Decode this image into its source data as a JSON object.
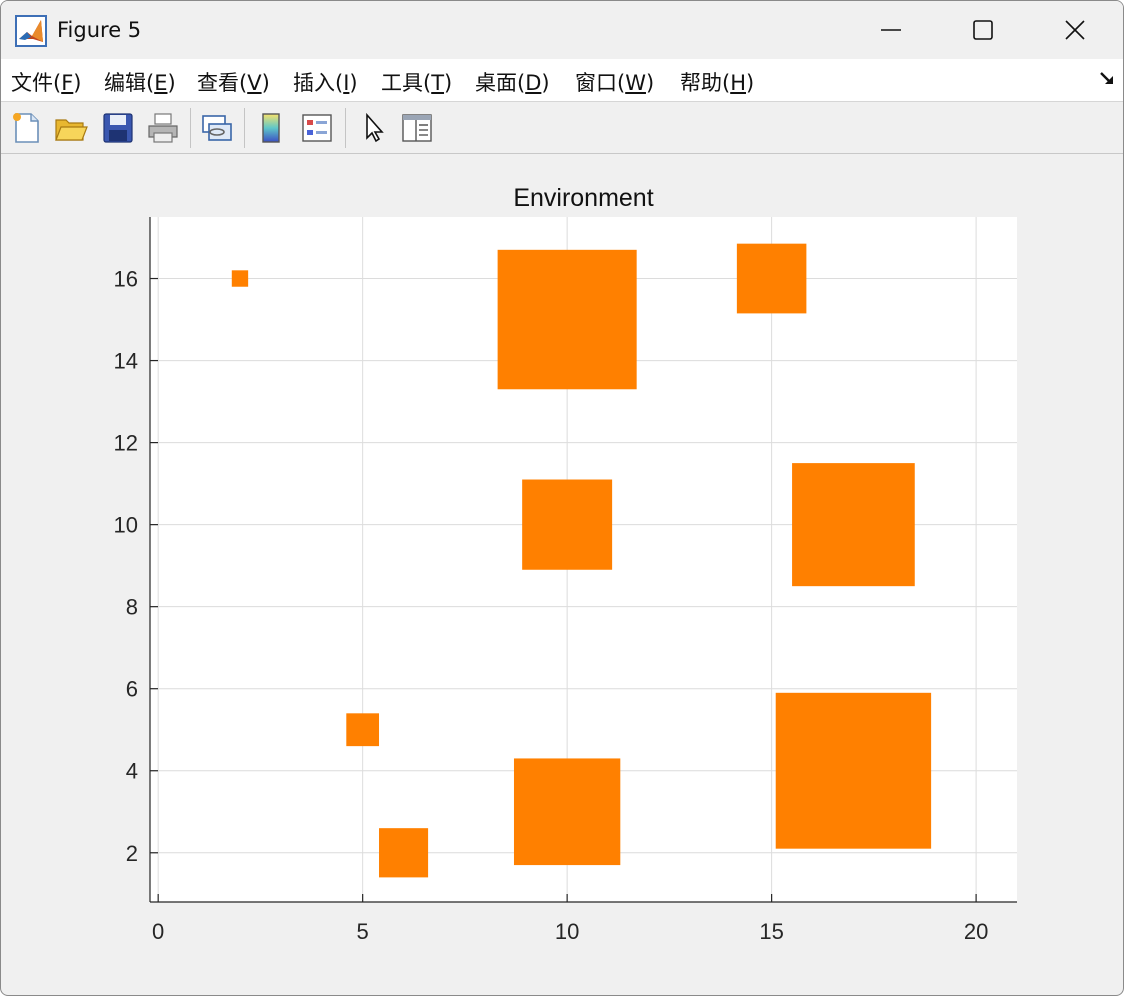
{
  "window": {
    "title": "Figure 5",
    "controls": {
      "minimize": "minimize",
      "maximize": "maximize",
      "close": "close"
    }
  },
  "menu": [
    {
      "label": "文件(",
      "key": "F",
      "suffix": ")"
    },
    {
      "label": "编辑(",
      "key": "E",
      "suffix": ")"
    },
    {
      "label": "查看(",
      "key": "V",
      "suffix": ")"
    },
    {
      "label": "插入(",
      "key": "I",
      "suffix": ")"
    },
    {
      "label": "工具(",
      "key": "T",
      "suffix": ")"
    },
    {
      "label": "桌面(",
      "key": "D",
      "suffix": ")"
    },
    {
      "label": "窗口(",
      "key": "W",
      "suffix": ")"
    },
    {
      "label": "帮助(",
      "key": "H",
      "suffix": ")"
    }
  ],
  "toolbar": {
    "icons": [
      "new-figure-icon",
      "open-file-icon",
      "save-icon",
      "print-icon",
      "link-plot-icon",
      "colorbar-icon",
      "legend-icon",
      "pointer-icon",
      "property-inspector-icon"
    ]
  },
  "chart_data": {
    "type": "scatter",
    "title": "Environment",
    "xlabel": "",
    "ylabel": "",
    "xlim": [
      -0.2,
      21
    ],
    "ylim": [
      0.8,
      17.5
    ],
    "xticks": [
      0,
      5,
      10,
      15,
      20
    ],
    "yticks": [
      2,
      4,
      6,
      8,
      10,
      12,
      14,
      16
    ],
    "grid": true,
    "color": "#ff8000",
    "obstacles": [
      {
        "x": [
          1.8,
          2.2
        ],
        "y": [
          15.8,
          16.2
        ]
      },
      {
        "x": [
          4.6,
          5.4
        ],
        "y": [
          4.6,
          5.4
        ]
      },
      {
        "x": [
          5.4,
          6.6
        ],
        "y": [
          1.4,
          2.6
        ]
      },
      {
        "x": [
          8.3,
          11.7
        ],
        "y": [
          13.3,
          16.7
        ]
      },
      {
        "x": [
          8.9,
          11.1
        ],
        "y": [
          8.9,
          11.1
        ]
      },
      {
        "x": [
          8.7,
          11.3
        ],
        "y": [
          1.7,
          4.3
        ]
      },
      {
        "x": [
          14.15,
          15.85
        ],
        "y": [
          15.15,
          16.85
        ]
      },
      {
        "x": [
          15.5,
          18.5
        ],
        "y": [
          8.5,
          11.5
        ]
      },
      {
        "x": [
          15.1,
          18.9
        ],
        "y": [
          2.1,
          5.9
        ]
      }
    ]
  }
}
